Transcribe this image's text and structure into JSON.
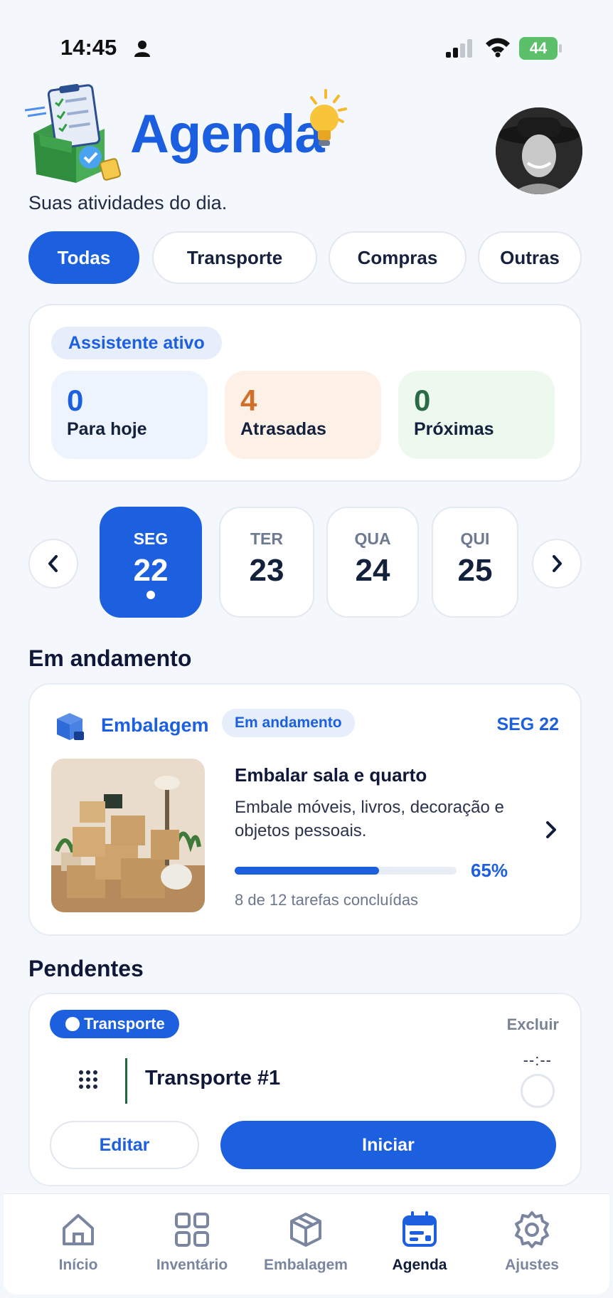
{
  "status_bar": {
    "time": "14:45",
    "battery": "44"
  },
  "header": {
    "title": "Agenda",
    "subtitle": "Suas atividades do dia."
  },
  "filters": [
    {
      "label": "Todas",
      "active": true
    },
    {
      "label": "Transporte",
      "active": false
    },
    {
      "label": "Compras",
      "active": false
    },
    {
      "label": "Outras",
      "active": false
    }
  ],
  "assistant": {
    "badge": "Assistente ativo",
    "stats": [
      {
        "value": "0",
        "label": "Para hoje",
        "color": "#1c5fdf",
        "bg": "#eef4fe"
      },
      {
        "value": "4",
        "label": "Atrasadas",
        "color": "#cf6f2a",
        "bg": "#fdf0e6"
      },
      {
        "value": "0",
        "label": "Próximas",
        "color": "#2a6b47",
        "bg": "#edf9ef"
      }
    ]
  },
  "days": [
    {
      "name": "SEG",
      "num": "22",
      "active": true
    },
    {
      "name": "TER",
      "num": "23",
      "active": false
    },
    {
      "name": "QUA",
      "num": "24",
      "active": false
    },
    {
      "name": "QUI",
      "num": "25",
      "active": false
    }
  ],
  "in_progress": {
    "section_title": "Em andamento",
    "category": "Embalagem",
    "status": "Em andamento",
    "date": "SEG 22",
    "task_title": "Embalar sala e quarto",
    "task_desc": "Embale móveis, livros, decoração e objetos pessoais.",
    "progress_percent": 65,
    "progress_label": "65%",
    "tasks_done": "8 de 12 tarefas concluídas"
  },
  "pending": {
    "section_title": "Pendentes",
    "type": "Transporte",
    "delete_label": "Excluir",
    "title": "Transporte #1",
    "time_placeholder": "--:--",
    "edit_label": "Editar",
    "start_label": "Iniciar"
  },
  "bottom_nav": [
    {
      "label": "Início",
      "icon": "home-icon",
      "active": false
    },
    {
      "label": "Inventário",
      "icon": "grid-icon",
      "active": false
    },
    {
      "label": "Embalagem",
      "icon": "box-icon",
      "active": false
    },
    {
      "label": "Agenda",
      "icon": "calendar-icon",
      "active": true
    },
    {
      "label": "Ajustes",
      "icon": "gear-icon",
      "active": false
    }
  ],
  "colors": {
    "accent": "#1c5fdf",
    "background": "#f4f7fc"
  }
}
